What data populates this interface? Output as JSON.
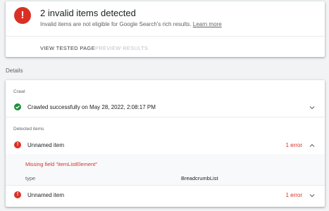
{
  "summary": {
    "title": "2 invalid items detected",
    "subtitle": "Invalid items are not eligible for Google Search's rich results.",
    "learn_more": "Learn more",
    "icon": "error-icon",
    "tabs": [
      "VIEW TESTED PAGE",
      "PREVIEW RESULTS"
    ]
  },
  "details_label": "Details",
  "crawl": {
    "label": "Crawl",
    "status": "Crawled successfully on May 28, 2022, 2:08:17 PM",
    "icon": "check-circle-icon"
  },
  "detected": {
    "label": "Detected items",
    "items": [
      {
        "name": "Unnamed item",
        "errors": "1 error",
        "expanded": true,
        "issue": "Missing field \"itemListElement\"",
        "field_key": "type",
        "field_value": "BreadcrumbList"
      },
      {
        "name": "Unnamed item",
        "errors": "1 error",
        "expanded": false
      }
    ]
  },
  "colors": {
    "error": "#d93025",
    "success": "#1e8e3e",
    "link": "#5f6368",
    "disabled": "#bdc1c6"
  }
}
